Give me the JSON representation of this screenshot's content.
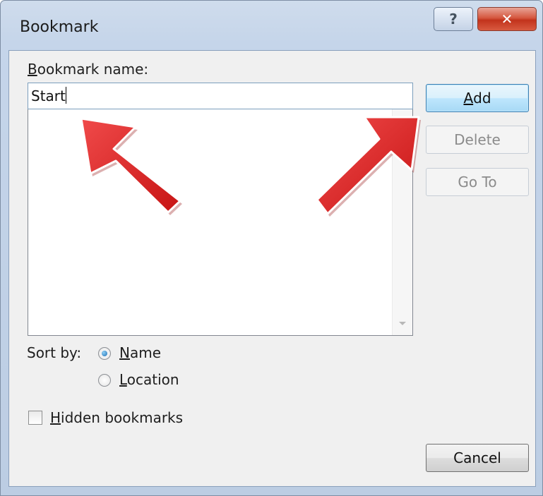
{
  "dialog": {
    "title": "Bookmark",
    "help_glyph": "?",
    "close_glyph": "✕"
  },
  "name_field": {
    "label_accel": "B",
    "label_rest": "ookmark name:",
    "value": "Start"
  },
  "buttons": {
    "add_accel": "A",
    "add_rest": "dd",
    "delete": "Delete",
    "goto": "Go To",
    "cancel": "Cancel"
  },
  "sort": {
    "label": "Sort by:",
    "name_accel": "N",
    "name_rest": "ame",
    "location_accel": "L",
    "location_rest": "ocation",
    "selected": "Name"
  },
  "hidden": {
    "accel": "H",
    "rest": "idden bookmarks",
    "checked": false
  },
  "annotation_color": "#e21b1b"
}
